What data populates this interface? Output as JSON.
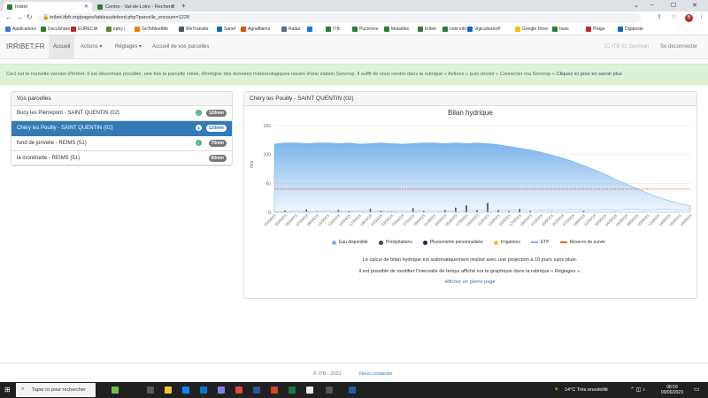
{
  "browser": {
    "tabs": [
      {
        "title": "Irribet",
        "active": true
      },
      {
        "title": "Centre - Val-de-Loire - Recherch",
        "active": false
      }
    ],
    "new_tab": "+",
    "window_controls": {
      "minimize": "–",
      "maximize": "☐",
      "close": "✕"
    },
    "url": "irribet.itbfr.org/pages/tableaudebord.php?parcelle_encours=1228",
    "profile_initial": "B",
    "bookmarks": [
      {
        "label": "Applications",
        "color": "#4a6ee0"
      },
      {
        "label": "DocuShare",
        "color": "#2e7d32"
      },
      {
        "label": "EURECIA",
        "color": "#c62828"
      },
      {
        "label": "ephy |",
        "color": "#558b2f"
      },
      {
        "label": "GoToMeetMe",
        "color": "#f57c00"
      },
      {
        "label": "WeTransfer",
        "color": "#455a64"
      },
      {
        "label": "Sanef",
        "color": "#1565c0"
      },
      {
        "label": "Agriaffaires",
        "color": "#e65100"
      },
      {
        "label": "Radar",
        "color": "#546e7a"
      },
      {
        "label": "",
        "color": "#1a73e8"
      },
      {
        "label": "ITB",
        "color": "#2e7d32"
      },
      {
        "label": "Pucerons",
        "color": "#2e7d32"
      },
      {
        "label": "Maladies",
        "color": "#2e7d32"
      },
      {
        "label": "Irribet",
        "color": "#2e7d32"
      },
      {
        "label": "note info",
        "color": "#2e7d32"
      },
      {
        "label": "Vigicultures®",
        "color": "#1565c0"
      },
      {
        "label": "Google Drive",
        "color": "#fbbc04"
      },
      {
        "label": "buse",
        "color": "#2e7d32"
      },
      {
        "label": "Pixigo",
        "color": "#c62828"
      },
      {
        "label": "Digiposte",
        "color": "#1565c0"
      }
    ]
  },
  "navbar": {
    "brand": "IRRIBET.FR",
    "items": [
      {
        "label": "Accueil"
      },
      {
        "label": "Actions ▾"
      },
      {
        "label": "Réglages ▾"
      },
      {
        "label": "Accueil de vos parcelles"
      }
    ],
    "user": "JC ITB 02 Germain",
    "logout": "Se deconnecter"
  },
  "alert": {
    "text": "Ceci est la nouvelle version d'Irribet. Il est désormais possible, une fois la parcelle créée, d'intégrer des données météorologiques issues d'une station Sencrop. Il suffit de vous rendre dans la rubrique « Actions » puis choisir « Connecter ma Sencrop »",
    "link": "Cliquez ici pour en savoir plus"
  },
  "parcelles": {
    "heading": "Vos parcelles",
    "items": [
      {
        "name": "Bucy les Pierrepont - SAINT QUENTIN (02)",
        "badge": "120mm",
        "irrigated": true,
        "active": false
      },
      {
        "name": "Chéry les Pouilly - SAINT QUENTIN (02)",
        "badge": "120mm",
        "irrigated": true,
        "active": true
      },
      {
        "name": "fond de jonvelle - REIMS (51)",
        "badge": "70mm",
        "irrigated": true,
        "active": false
      },
      {
        "name": "la montinette - REIMS (51)",
        "badge": "80mm",
        "irrigated": false,
        "active": false
      }
    ]
  },
  "detail": {
    "heading": "Chéry les Pouilly - SAINT QUENTIN (02)",
    "info_line1": "Le calcul de bilan hydrique est automatiquement réalisé avec une projection à 10 jours sans pluie.",
    "info_line2": "Il est possible de modifier l'intervalle de temps affiché sur le graphique dans la rubrique « Réglages ».",
    "fullpage_link": "Afficher en pleine page"
  },
  "chart_data": {
    "type": "area",
    "title": "Bilan hydrique",
    "ylabel": "mm",
    "ylim": [
      0,
      150
    ],
    "yticks": [
      0,
      50,
      100,
      150
    ],
    "grid": true,
    "legend_position": "bottom",
    "x": [
      "01/04/23",
      "03/04/23",
      "05/04/23",
      "07/04/23",
      "09/04/23",
      "11/04/23",
      "13/04/23",
      "15/04/23",
      "17/04/23",
      "19/04/23",
      "21/04/23",
      "23/04/23",
      "25/04/23",
      "27/04/23",
      "29/04/23",
      "01/05/23",
      "03/05/23",
      "05/05/23",
      "07/05/23",
      "09/05/23",
      "11/05/23",
      "13/05/23",
      "15/05/23",
      "17/05/23",
      "19/05/23",
      "21/05/23",
      "23/05/23",
      "25/05/23",
      "27/05/23",
      "29/05/23",
      "31/05/23",
      "02/06/23",
      "04/06/23",
      "06/06/23",
      "08/06/23",
      "10/06/23",
      "12/06/23",
      "14/06/23",
      "16/06/23",
      "18/06/23"
    ],
    "series": [
      {
        "name": "Eau disponible",
        "type": "area",
        "color": "#7cb5ec",
        "values": [
          118,
          120,
          120,
          119,
          120,
          120,
          119,
          120,
          118,
          119,
          120,
          119,
          118,
          119,
          120,
          120,
          119,
          120,
          119,
          120,
          119,
          117,
          114,
          111,
          108,
          104,
          99,
          94,
          88,
          81,
          74,
          66,
          57,
          49,
          41,
          33,
          26,
          20,
          15,
          11
        ]
      },
      {
        "name": "Précipitations",
        "type": "bar",
        "color": "#434348",
        "values": [
          0,
          3,
          0,
          5,
          1,
          0,
          4,
          2,
          0,
          6,
          3,
          1,
          0,
          7,
          2,
          0,
          4,
          8,
          12,
          3,
          16,
          4,
          2,
          6,
          2,
          0,
          1,
          0,
          0,
          2,
          0,
          0,
          1,
          0,
          0,
          0,
          0,
          0,
          0,
          0
        ]
      },
      {
        "name": "Pluviometrie personnalisée",
        "type": "bar",
        "color": "#1c2b4a",
        "values": []
      },
      {
        "name": "Irrigations",
        "type": "bar",
        "color": "#f7c71c",
        "values": []
      },
      {
        "name": "ETP",
        "type": "line",
        "color": "#7cb5ec",
        "values": [
          1,
          1,
          2,
          1,
          2,
          2,
          1,
          2,
          2,
          3,
          2,
          2,
          3,
          2,
          3,
          3,
          2,
          3,
          3,
          4,
          3,
          3,
          4,
          4,
          3,
          4,
          4,
          4,
          5,
          4,
          4,
          5,
          4,
          5,
          5,
          4,
          5,
          5,
          4,
          5
        ]
      },
      {
        "name": "Réserve de survie",
        "type": "line",
        "color": "#e8681a",
        "values": [
          40,
          40,
          40,
          40,
          40,
          40,
          40,
          40,
          40,
          40,
          40,
          40,
          40,
          40,
          40,
          40,
          40,
          40,
          40,
          40,
          40,
          40,
          40,
          40,
          40,
          40,
          40,
          40,
          40,
          40,
          40,
          40,
          40,
          40,
          40,
          40,
          40,
          40,
          40,
          40
        ]
      }
    ]
  },
  "footer": {
    "copyright": "© ITB - 2021",
    "contact": "Nous contacter"
  },
  "taskbar": {
    "search_placeholder": "Taper ici pour rechercher",
    "weather": "14°C  Très ensoleillé",
    "time": "08:59",
    "date": "09/06/2023"
  }
}
